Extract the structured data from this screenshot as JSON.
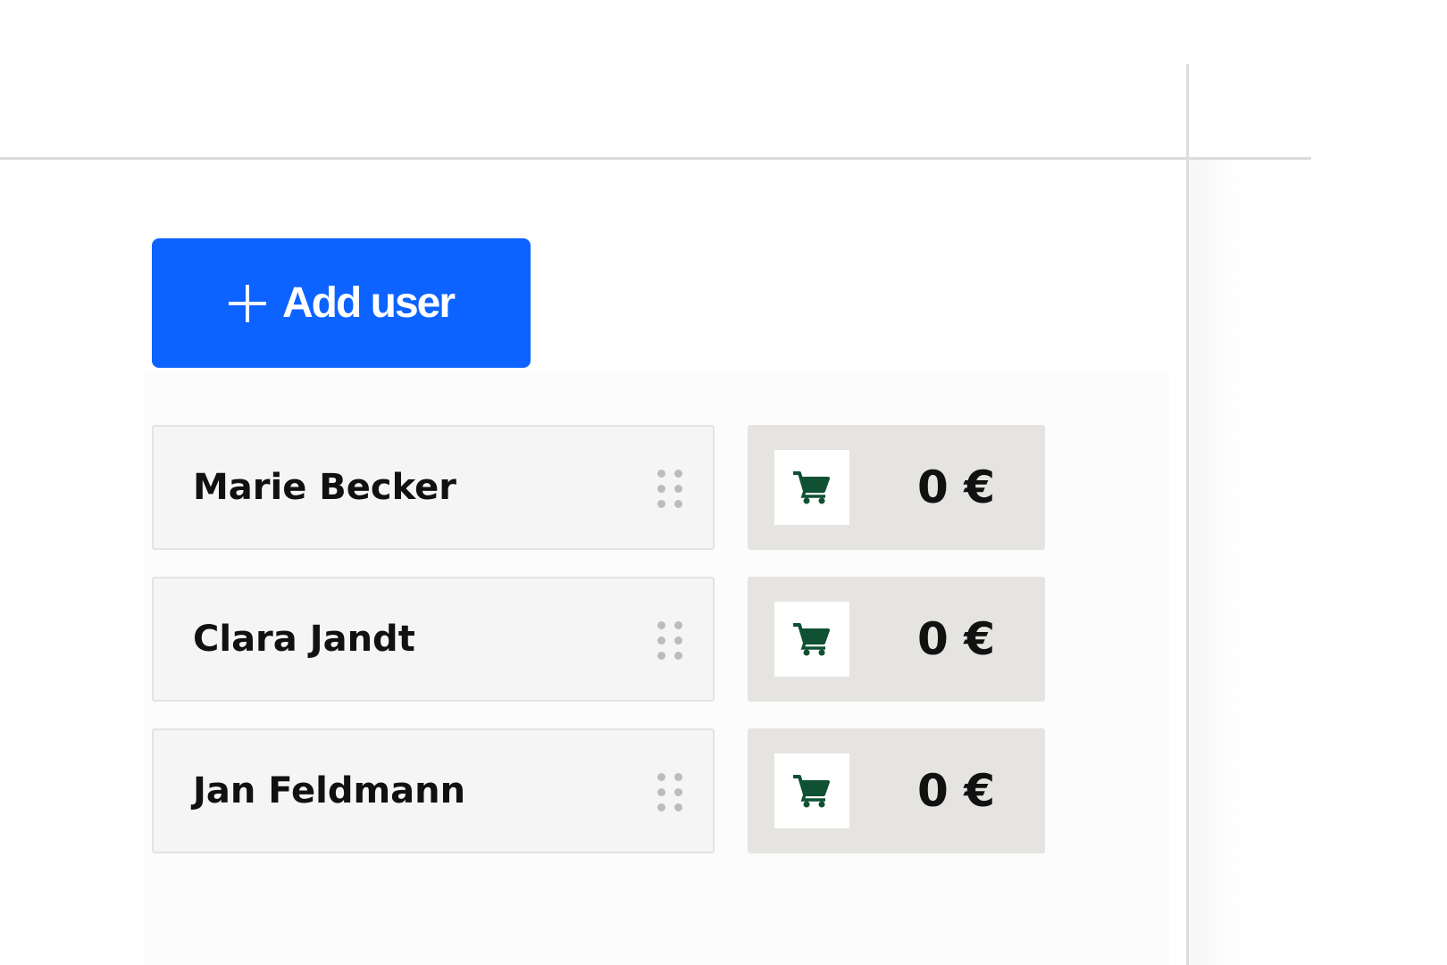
{
  "toolbar": {
    "add_user_label": "Add user"
  },
  "colors": {
    "primary": "#0d63ff",
    "cart_icon": "#0f5132",
    "card_bg": "#f6f5f5",
    "price_bg": "#e5e4e1"
  },
  "users": [
    {
      "name": "Marie Becker",
      "amount": "0 €"
    },
    {
      "name": "Clara Jandt",
      "amount": "0 €"
    },
    {
      "name": "Jan Feldmann",
      "amount": "0 €"
    }
  ],
  "icons": {
    "add": "plus-icon",
    "cart": "shopping-cart-icon",
    "drag": "drag-handle-icon"
  }
}
